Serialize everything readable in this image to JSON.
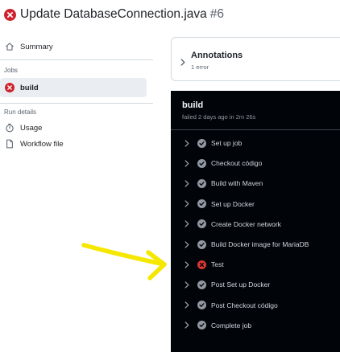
{
  "header": {
    "title": "Update DatabaseConnection.java",
    "run_number": "#6",
    "status_icon": "x-circle-fill-icon",
    "status_color": "#cf222e"
  },
  "sidebar": {
    "summary_label": "Summary",
    "jobs_heading": "Jobs",
    "jobs": [
      {
        "label": "build",
        "status": "failed"
      }
    ],
    "run_details_heading": "Run details",
    "run_details": [
      {
        "label": "Usage",
        "icon": "stopwatch-icon"
      },
      {
        "label": "Workflow file",
        "icon": "file-icon"
      }
    ]
  },
  "annotations": {
    "title": "Annotations",
    "count": "1 error"
  },
  "job": {
    "name": "build",
    "status_line": "failed 2 days ago in 2m 26s",
    "steps": [
      {
        "label": "Set up job",
        "status": "success"
      },
      {
        "label": "Checkout código",
        "status": "success"
      },
      {
        "label": "Build with Maven",
        "status": "success"
      },
      {
        "label": "Set up Docker",
        "status": "success"
      },
      {
        "label": "Create Docker network",
        "status": "success"
      },
      {
        "label": "Build Docker image for MariaDB",
        "status": "success"
      },
      {
        "label": "Test",
        "status": "failure"
      },
      {
        "label": "Post Set up Docker",
        "status": "success"
      },
      {
        "label": "Post Checkout código",
        "status": "success"
      },
      {
        "label": "Complete job",
        "status": "success"
      }
    ]
  },
  "colors": {
    "failure": "#da3633",
    "success_icon": "#9198a1",
    "log_background": "#010409",
    "annotation_arrow": "#f5e700"
  }
}
